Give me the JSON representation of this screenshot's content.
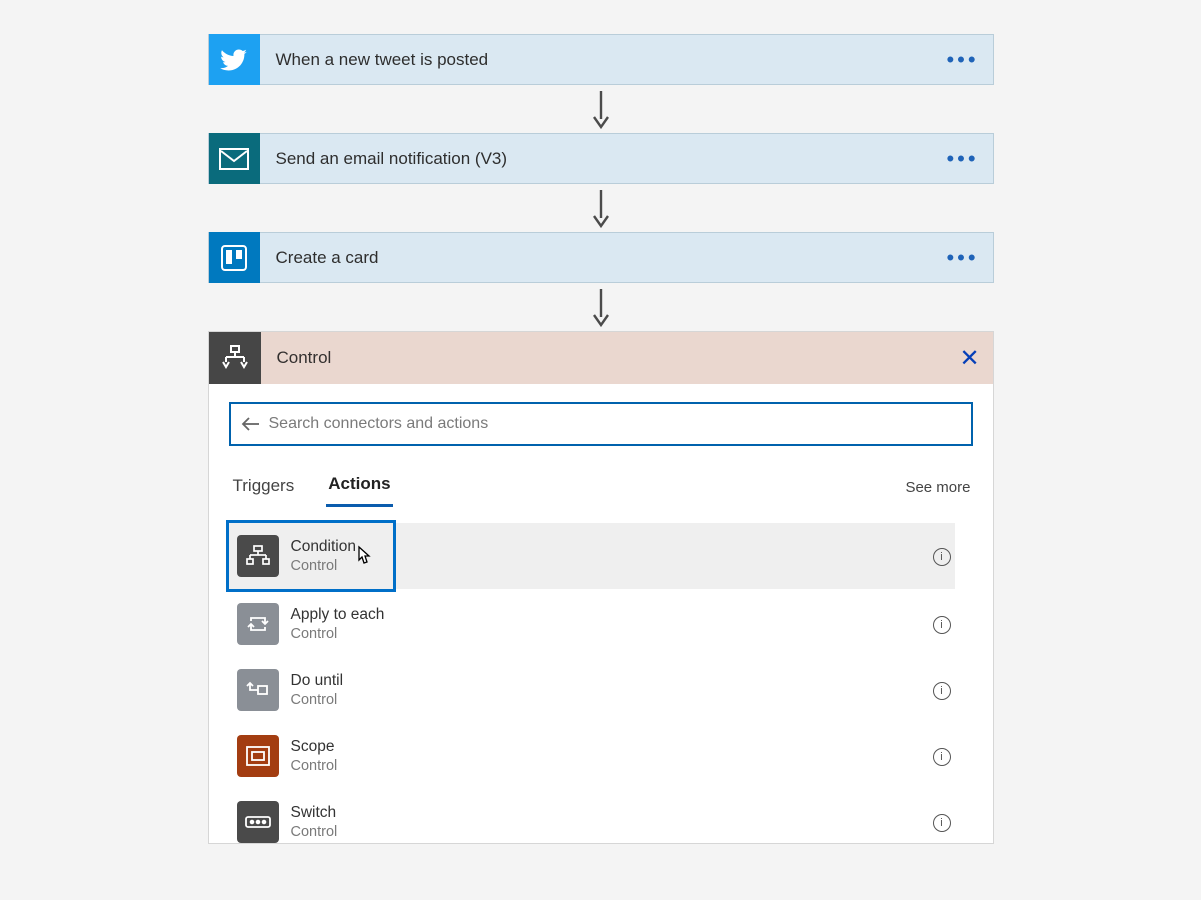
{
  "steps": [
    {
      "title": "When a new tweet is posted",
      "icon": "twitter"
    },
    {
      "title": "Send an email notification (V3)",
      "icon": "email"
    },
    {
      "title": "Create a card",
      "icon": "trello"
    }
  ],
  "panel": {
    "title": "Control",
    "search_placeholder": "Search connectors and actions",
    "tabs": {
      "triggers": "Triggers",
      "actions": "Actions"
    },
    "see_more": "See more"
  },
  "actions": [
    {
      "name": "Condition",
      "sub": "Control",
      "icon": "condition",
      "highlighted": true
    },
    {
      "name": "Apply to each",
      "sub": "Control",
      "icon": "loop"
    },
    {
      "name": "Do until",
      "sub": "Control",
      "icon": "dountil"
    },
    {
      "name": "Scope",
      "sub": "Control",
      "icon": "scope"
    },
    {
      "name": "Switch",
      "sub": "Control",
      "icon": "switch"
    }
  ]
}
